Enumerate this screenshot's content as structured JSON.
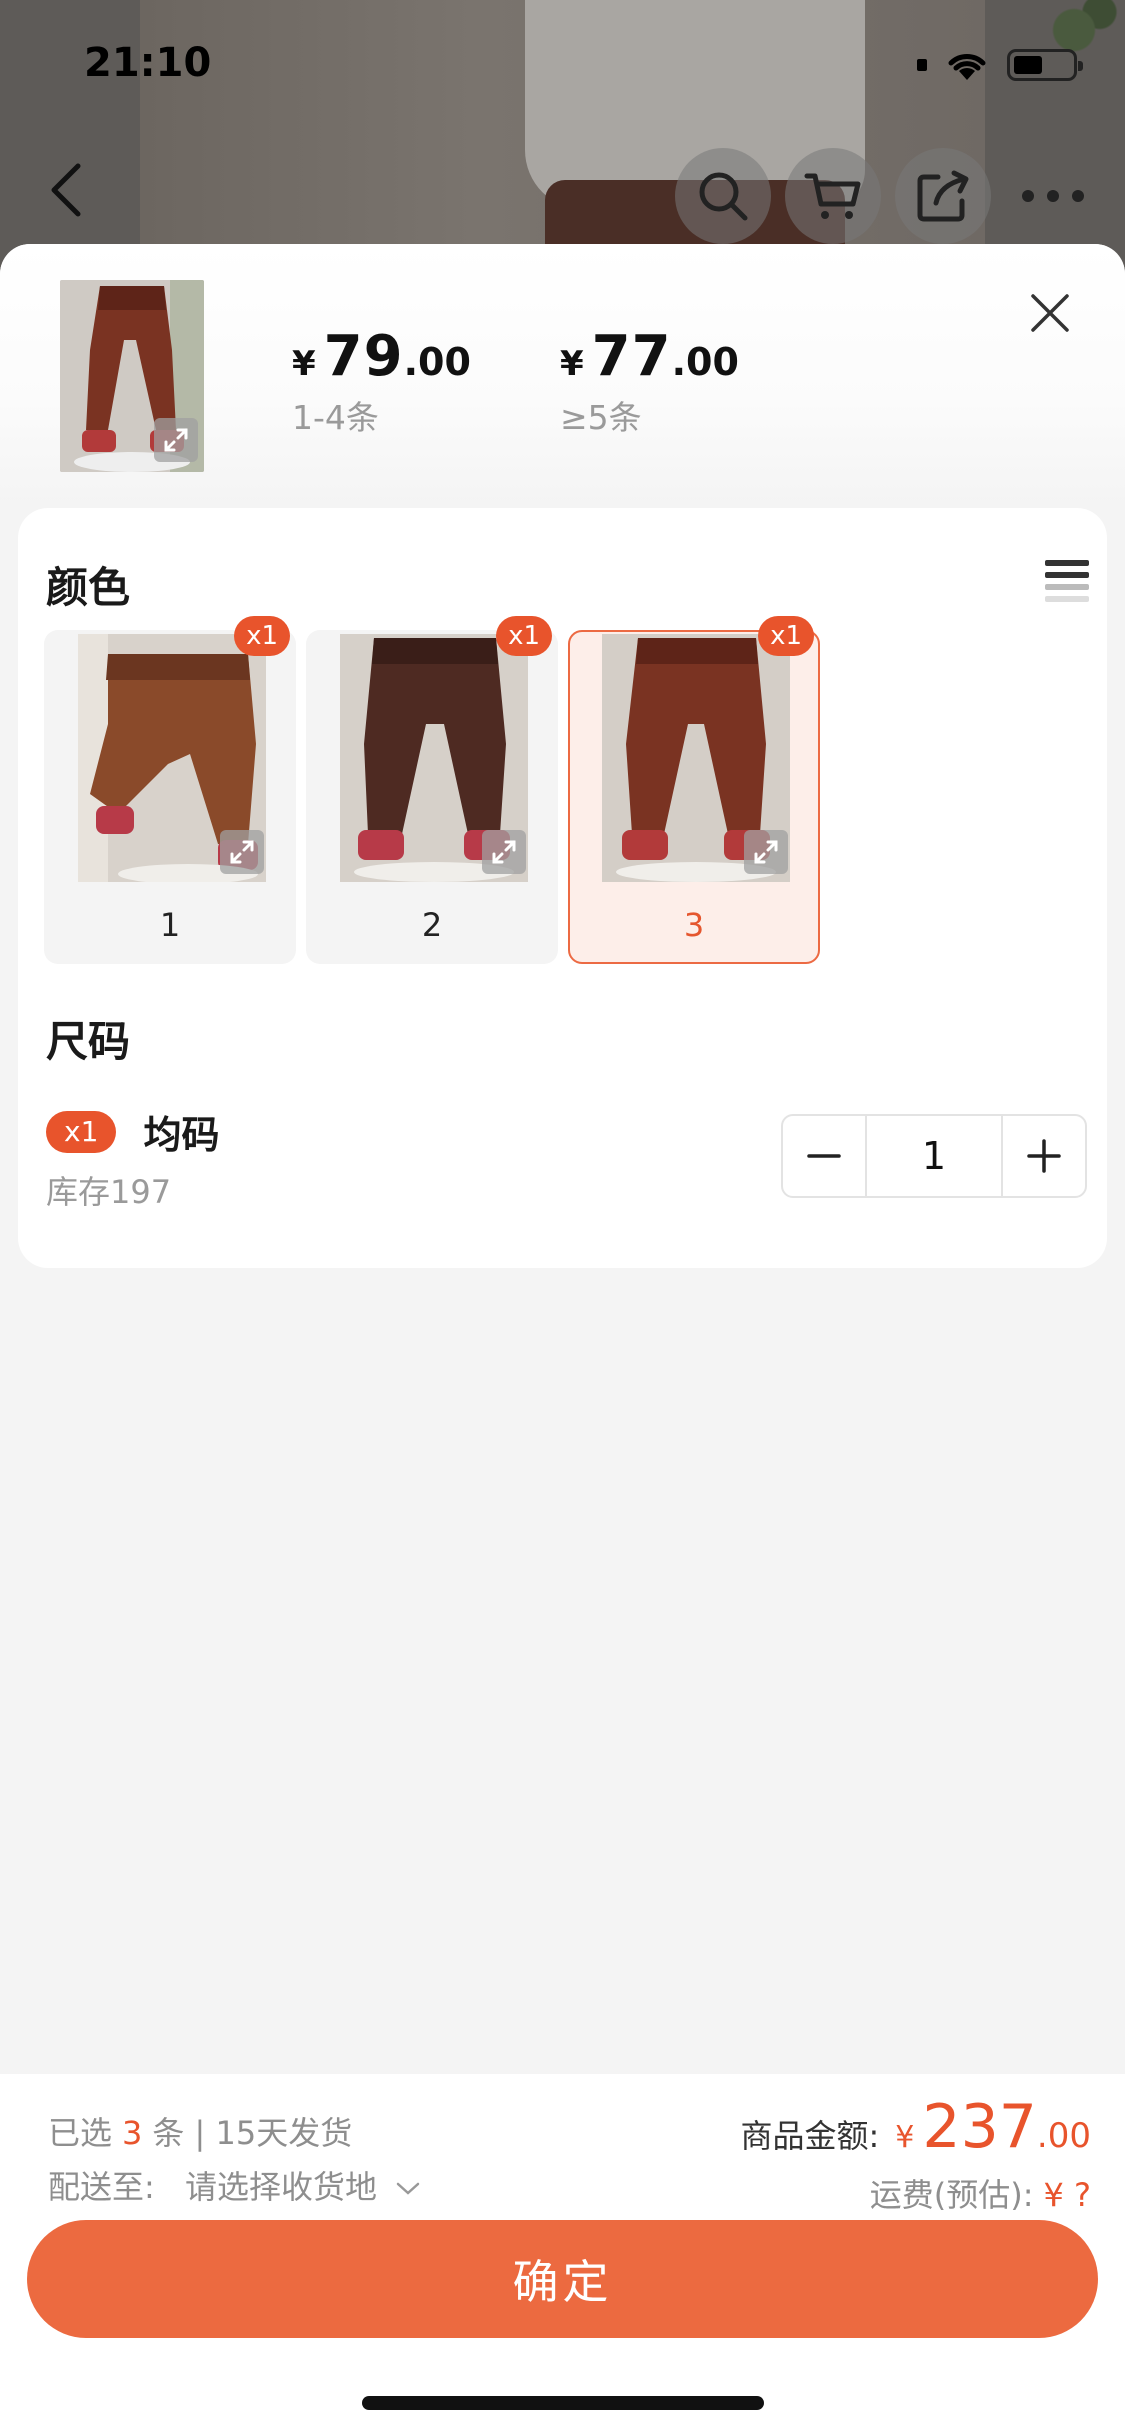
{
  "status_bar": {
    "time": "21:10"
  },
  "header": {
    "tiers": [
      {
        "currency": "¥",
        "integer": "79",
        "decimal": ".00",
        "range": "1-4条"
      },
      {
        "currency": "¥",
        "integer": "77",
        "decimal": ".00",
        "range": "≥5条"
      }
    ]
  },
  "color_section": {
    "title": "颜色",
    "options": [
      {
        "label": "1",
        "quantity_badge": "x1",
        "selected": false
      },
      {
        "label": "2",
        "quantity_badge": "x1",
        "selected": false
      },
      {
        "label": "3",
        "quantity_badge": "x1",
        "selected": true
      }
    ]
  },
  "size_section": {
    "title": "尺码",
    "item": {
      "quantity_badge": "x1",
      "name": "均码",
      "stock": "库存197"
    },
    "stepper": {
      "value": "1"
    }
  },
  "footer": {
    "selected_prefix": "已选",
    "selected_count": "3",
    "selected_suffix": "条 | 15天发货",
    "delivery_label": "配送至:",
    "delivery_value": "请选择收货地",
    "amount_label": "商品金额:",
    "amount_currency": "¥",
    "amount_integer": "237",
    "amount_decimal": ".00",
    "shipping_label": "运费(预估):",
    "shipping_value": "¥ ?",
    "confirm_label": "确定"
  },
  "colors": {
    "accent": "#e8542c",
    "button": "#ec6a40",
    "selected_bg": "#fdeee9"
  }
}
